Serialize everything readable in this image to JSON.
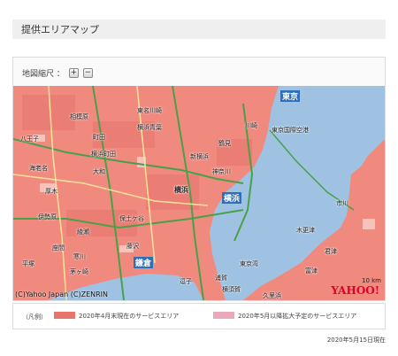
{
  "header": {
    "title": "提供エリアマップ"
  },
  "zoom": {
    "label": "地図縮尺 ：",
    "plus_label": "+",
    "minus_label": "−"
  },
  "map": {
    "labels": {
      "tokyo": "東京",
      "higashi_ogawa": "東名川崎",
      "sagamihara": "相模原",
      "yokohama_aoba": "横浜青葉",
      "kawasaki": "川崎",
      "machida": "町田",
      "hachioji": "八王子",
      "yokohama_machida": "横浜町田",
      "shin_yokohama": "新横浜",
      "yokohama_ward": "横浜",
      "yokohama": "横浜",
      "atsugi": "厚木",
      "isehara": "伊勢原",
      "fujisawa": "藤沢",
      "kamakura": "鎌倉",
      "chigasaki": "茅ヶ崎",
      "hiratsuka": "平塚",
      "zushi": "逗子",
      "yokosuka": "横須賀",
      "tokyo_bay": "東京湾",
      "haneda": "東京国際空港",
      "kisarazu": "木更津",
      "futtsu": "富津",
      "kimitsu": "君津",
      "uraga": "浦賀",
      "kurihama": "久里浜",
      "samukawa": "寒川",
      "tsurumi": "鶴見",
      "hodogaya": "保土ケ谷",
      "ebina": "海老名",
      "ayase": "綾瀬",
      "zama": "座間",
      "yamato": "大和",
      "kanagawa_ward": "神奈川",
      "ichikawa": "市川"
    },
    "copyright": "(C)Yahoo Japan (C)ZENRIN",
    "logo": "YAHOO!",
    "scale": "10 km"
  },
  "legend": {
    "prefix": "（凡例）",
    "item1": "2020年4月末現在のサービスエリア",
    "item2": "2020年5月以降拡大予定のサービスエリア",
    "color1": "#e8756c",
    "color2": "#e8a9b9"
  },
  "footer": {
    "date": "2020年5月15日現在"
  }
}
